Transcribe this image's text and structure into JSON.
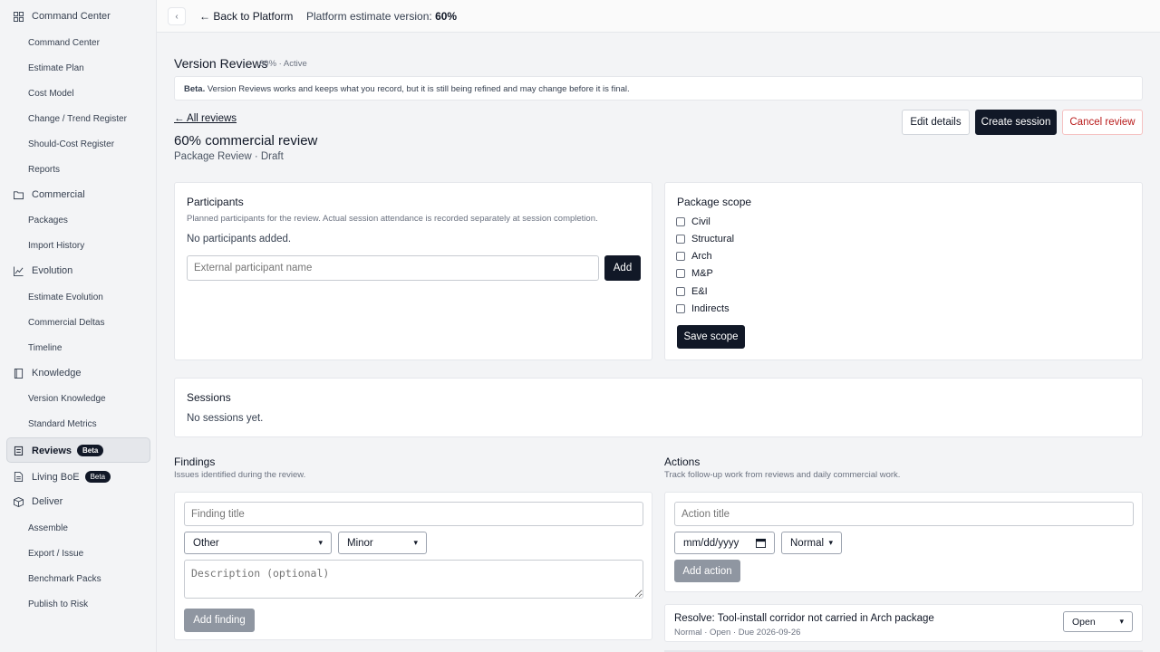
{
  "sidebar": {
    "sections": [
      {
        "label": "Command Center",
        "icon": "grid-icon"
      },
      {
        "label": "Commercial",
        "icon": "folder-icon"
      },
      {
        "label": "Evolution",
        "icon": "chart-line-icon"
      },
      {
        "label": "Knowledge",
        "icon": "book-icon"
      },
      {
        "label": "Reviews",
        "icon": "clipboard-icon",
        "badge": "Beta"
      },
      {
        "label": "Living BoE",
        "icon": "document-icon",
        "badge": "Beta"
      },
      {
        "label": "Deliver",
        "icon": "box-icon"
      }
    ],
    "items": {
      "command_center": [
        "Command Center",
        "Estimate Plan",
        "Cost Model",
        "Change / Trend Register",
        "Should-Cost Register",
        "Reports"
      ],
      "commercial": [
        "Packages",
        "Import History"
      ],
      "evolution": [
        "Estimate Evolution",
        "Commercial Deltas",
        "Timeline"
      ],
      "knowledge": [
        "Version Knowledge",
        "Standard Metrics"
      ],
      "deliver": [
        "Assemble",
        "Export / Issue",
        "Benchmark Packs",
        "Publish to Risk"
      ]
    }
  },
  "topbar": {
    "collapse_glyph": "‹",
    "back_label": "← Back to Platform",
    "version_prefix": "Platform estimate version:",
    "version_value": "60%"
  },
  "page": {
    "title": "Version Reviews",
    "subtitle": "60% · Active",
    "beta_strong": "Beta.",
    "beta_text": "Version Reviews works and keeps what you record, but it is still being refined and may change before it is final.",
    "all_reviews": "← All reviews",
    "review_title": "60% commercial review",
    "review_meta": "Package Review · Draft",
    "buttons": {
      "edit": "Edit details",
      "create": "Create session",
      "cancel": "Cancel review"
    }
  },
  "participants": {
    "title": "Participants",
    "desc": "Planned participants for the review. Actual session attendance is recorded separately at session completion.",
    "empty": "No participants added.",
    "placeholder": "External participant name",
    "add": "Add"
  },
  "scope": {
    "title": "Package scope",
    "options": [
      "Civil",
      "Structural",
      "Arch",
      "M&P",
      "E&I",
      "Indirects"
    ],
    "save": "Save scope"
  },
  "sessions": {
    "title": "Sessions",
    "empty": "No sessions yet."
  },
  "findings": {
    "title": "Findings",
    "desc": "Issues identified during the review.",
    "title_placeholder": "Finding title",
    "category": "Other",
    "severity": "Minor",
    "desc_placeholder": "Description (optional)",
    "add": "Add finding"
  },
  "actions": {
    "title": "Actions",
    "desc": "Track follow-up work from reviews and daily commercial work.",
    "title_placeholder": "Action title",
    "date_placeholder": "mm/dd/yyyy",
    "priority": "Normal",
    "add": "Add action",
    "item": {
      "title": "Resolve: Tool-install corridor not carried in Arch package",
      "meta": "Normal · Open · Due 2026-09-26",
      "status": "Open"
    }
  }
}
